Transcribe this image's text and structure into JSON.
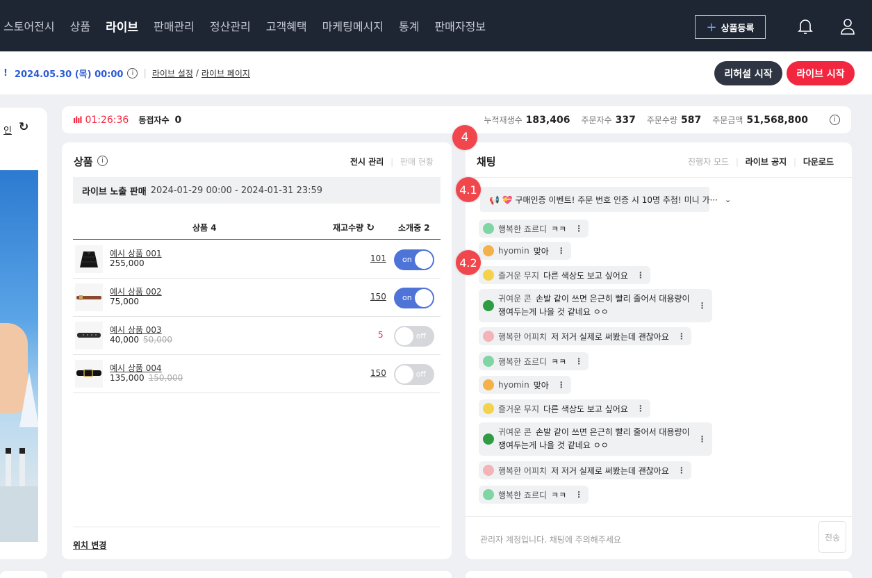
{
  "nav": {
    "items": [
      "스토어전시",
      "상품",
      "라이브",
      "판매관리",
      "정산관리",
      "고객혜택",
      "마케팅메시지",
      "통계",
      "판매자정보"
    ],
    "active_index": 2,
    "register_label": "상품등록"
  },
  "subbar": {
    "bang": "!",
    "date": "2024.05.30 (목) 00:00",
    "info": "i",
    "sep": "|",
    "link_settings": "라이브 설정",
    "slash": "/",
    "link_page": "라이브 페이지",
    "rehearsal_label": "리허설 시작",
    "live_label": "라이브 시작"
  },
  "left": {
    "label": "인",
    "refresh": "↻"
  },
  "stats": {
    "wave": "ılıl",
    "time": "01:26:36",
    "viewers_label": "동접자수",
    "viewers_value": "0",
    "cumulative_label": "누적재생수",
    "cumulative_value": "183,406",
    "orders_label": "주문자수",
    "orders_value": "337",
    "qty_label": "주문수량",
    "qty_value": "587",
    "amount_label": "주문금액",
    "amount_value": "51,568,800",
    "info": "i"
  },
  "products": {
    "title": "상품",
    "info": "i",
    "tab_display": "전시 관리",
    "tab_bar": "|",
    "tab_status": "판매 현황",
    "sale_label": "라이브 노출 판매",
    "sale_period": "2024-01-29 00:00 - 2024-01-31 23:59",
    "col_product": "상품 4",
    "col_stock": "재고수량",
    "col_stock_icon": "↻",
    "col_intro": "소개중 2",
    "rows": [
      {
        "name": "예시 상품 001",
        "price": "255,000",
        "old": "",
        "stock": "101",
        "toggle": "on"
      },
      {
        "name": "예시 상품 002",
        "price": "75,000",
        "old": "",
        "stock": "150",
        "toggle": "on"
      },
      {
        "name": "예시 상품 003",
        "price": "40,000",
        "old": "50,000",
        "stock": "5",
        "toggle": "off"
      },
      {
        "name": "예시 상품 004",
        "price": "135,000",
        "old": "150,000",
        "stock": "150",
        "toggle": "off"
      }
    ],
    "location_label": "위치 변경"
  },
  "chat": {
    "title": "채팅",
    "tab_host": "진행자 모드",
    "tab_bar": "|",
    "tab_notice": "라이브 공지",
    "tab_download": "다운로드",
    "notice": "📢 💝 구매인증 이벤트! 주문 번호 인증 시 10명 추첨! 미니 가···",
    "notice_chev": "⌄",
    "more": "⋮",
    "messages": [
      {
        "nick": "행복한 죠르디",
        "text": "ㅋㅋ",
        "color": "#7fd6a4"
      },
      {
        "nick": "hyomin",
        "text": "맞아",
        "color": "#f5b04a"
      },
      {
        "nick": "즐거운 무지",
        "text": "다른 색상도 보고 싶어요",
        "color": "#f5d24a"
      },
      {
        "nick": "귀여운 콘",
        "text": "손발 같이 쓰면 은근히 빨리 줄어서 대용량이",
        "text2": "쟁여두는게 나을 것 같네요 ㅇㅇ",
        "color": "#2e9c43"
      },
      {
        "nick": "행복한 어피치",
        "text": "저 저거 실제로 써봤는데 괜찮아요",
        "color": "#f4b3b8"
      },
      {
        "nick": "행복한 죠르디",
        "text": "ㅋㅋ",
        "color": "#7fd6a4"
      },
      {
        "nick": "hyomin",
        "text": "맞아",
        "color": "#f5b04a"
      },
      {
        "nick": "즐거운 무지",
        "text": "다른 색상도 보고 싶어요",
        "color": "#f5d24a"
      },
      {
        "nick": "귀여운 콘",
        "text": "손발 같이 쓰면 은근히 빨리 줄어서 대용량이",
        "text2": "쟁여두는게 나을 것 같네요 ㅇㅇ",
        "color": "#2e9c43"
      },
      {
        "nick": "행복한 어피치",
        "text": "저 저거 실제로 써봤는데 괜찮아요",
        "color": "#f4b3b8"
      },
      {
        "nick": "행복한 죠르디",
        "text": "ㅋㅋ",
        "color": "#7fd6a4"
      }
    ],
    "input_placeholder": "관리자 계정입니다. 채팅에 주의해주세요",
    "send_label": "전송"
  },
  "markers": [
    "4",
    "4.1",
    "4.2"
  ],
  "colors": {
    "accent": "#f3263f",
    "blue": "#2a5ad7",
    "toggle_on": "#4f74d8",
    "nav_bg": "#1e2533"
  }
}
